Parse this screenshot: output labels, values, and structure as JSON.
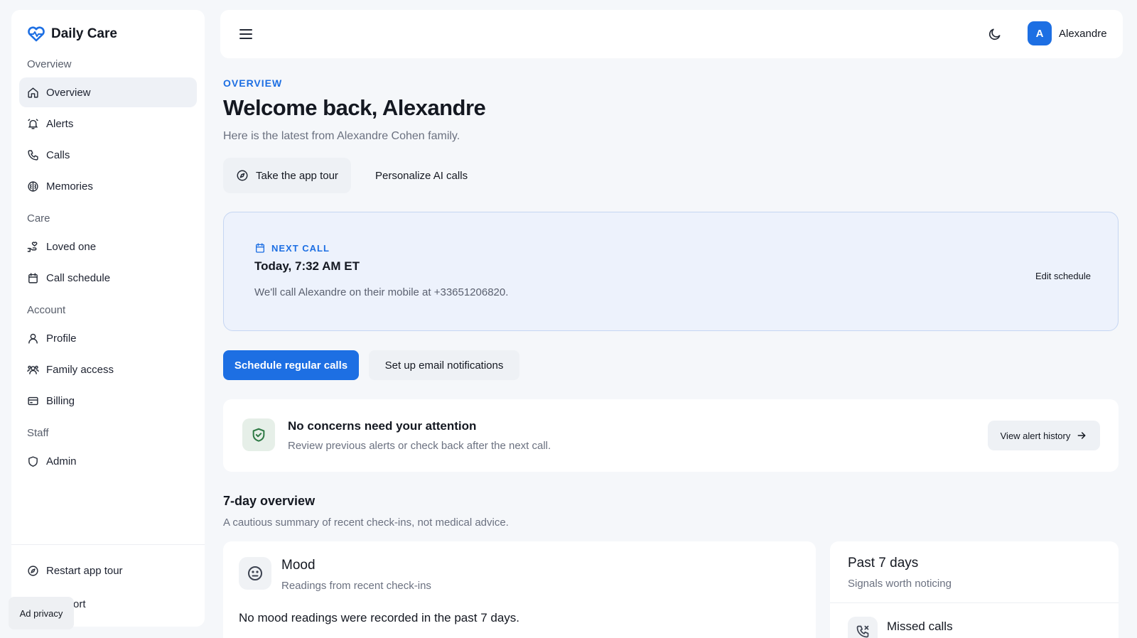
{
  "app": {
    "name": "Daily Care"
  },
  "sidebar": {
    "sections": [
      {
        "title": "Overview",
        "items": [
          {
            "label": "Overview",
            "icon": "home-icon",
            "active": true
          },
          {
            "label": "Alerts",
            "icon": "bell-icon"
          },
          {
            "label": "Calls",
            "icon": "phone-icon"
          },
          {
            "label": "Memories",
            "icon": "brain-icon"
          }
        ]
      },
      {
        "title": "Care",
        "items": [
          {
            "label": "Loved one",
            "icon": "hand-heart-icon"
          },
          {
            "label": "Call schedule",
            "icon": "calendar-icon"
          }
        ]
      },
      {
        "title": "Account",
        "items": [
          {
            "label": "Profile",
            "icon": "user-icon"
          },
          {
            "label": "Family access",
            "icon": "users-icon"
          },
          {
            "label": "Billing",
            "icon": "credit-card-icon"
          }
        ]
      },
      {
        "title": "Staff",
        "items": [
          {
            "label": "Admin",
            "icon": "shield-icon"
          }
        ]
      }
    ],
    "footer": {
      "restart_tour": "Restart app tour",
      "support_partial": "ort",
      "ad_privacy": "Ad privacy"
    }
  },
  "header": {
    "user_initial": "A",
    "user_name": "Alexandre"
  },
  "main": {
    "eyebrow": "OVERVIEW",
    "title": "Welcome back, Alexandre",
    "subtitle": "Here is the latest from Alexandre Cohen family.",
    "tour_button": "Take the app tour",
    "personalize_button": "Personalize AI calls",
    "next_call": {
      "label": "NEXT CALL",
      "time": "Today, 7:32 AM ET",
      "description": "We'll call Alexandre on their mobile at +33651206820.",
      "edit": "Edit schedule"
    },
    "schedule_button": "Schedule regular calls",
    "email_button": "Set up email notifications",
    "concerns": {
      "title": "No concerns need your attention",
      "subtitle": "Review previous alerts or check back after the next call.",
      "history_button": "View alert history"
    },
    "overview": {
      "title": "7-day overview",
      "subtitle": "A cautious summary of recent check-ins, not medical advice."
    },
    "mood": {
      "title": "Mood",
      "subtitle": "Readings from recent check-ins",
      "empty": "No mood readings were recorded in the past 7 days."
    },
    "past": {
      "title": "Past 7 days",
      "subtitle": "Signals worth noticing",
      "missed_calls": "Missed calls"
    }
  },
  "colors": {
    "accent": "#1d6fe3",
    "next_call_bg": "#edf2fc",
    "success_bg": "#e6efe8",
    "success_icon": "#2f7a45"
  }
}
